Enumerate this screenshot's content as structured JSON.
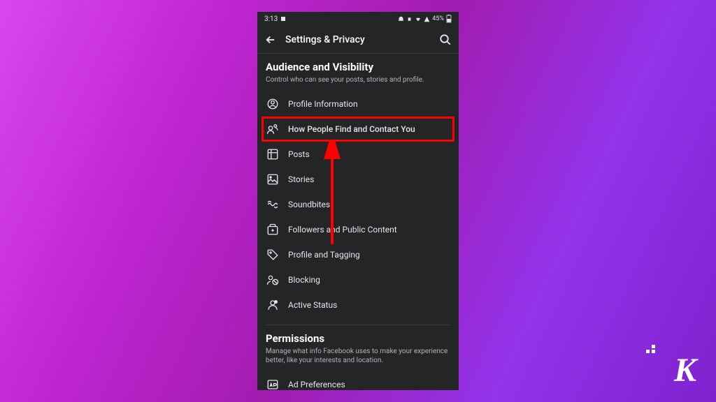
{
  "status_bar": {
    "time": "3:13",
    "battery": "45%"
  },
  "header": {
    "title": "Settings & Privacy"
  },
  "sections": {
    "audience": {
      "title": "Audience and Visibility",
      "subtitle": "Control who can see your posts, stories and profile.",
      "items": [
        {
          "label": "Profile Information"
        },
        {
          "label": "How People Find and Contact You"
        },
        {
          "label": "Posts"
        },
        {
          "label": "Stories"
        },
        {
          "label": "Soundbites"
        },
        {
          "label": "Followers and Public Content"
        },
        {
          "label": "Profile and Tagging"
        },
        {
          "label": "Blocking"
        },
        {
          "label": "Active Status"
        }
      ]
    },
    "permissions": {
      "title": "Permissions",
      "subtitle": "Manage what info Facebook uses to make your experience better, like your interests and location.",
      "items": [
        {
          "label": "Ad Preferences"
        }
      ]
    }
  },
  "watermark": "K"
}
